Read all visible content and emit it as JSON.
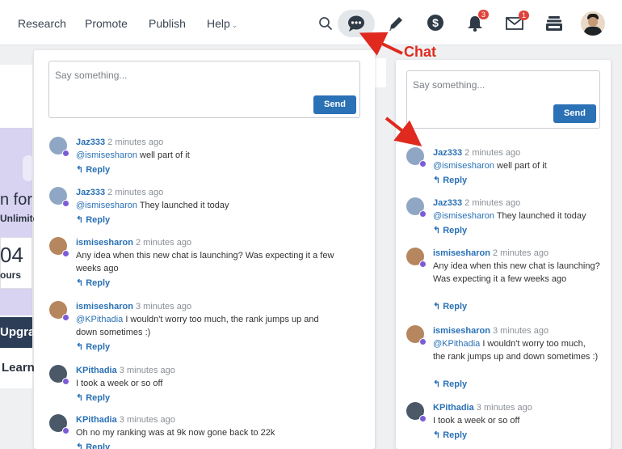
{
  "nav": {
    "links": [
      "Research",
      "Promote",
      "Publish",
      "Help"
    ],
    "notifications_badge": "3",
    "messages_badge": "1"
  },
  "background": {
    "text_for": "n for",
    "text_unlimited": "Unlimite",
    "number": "04",
    "hours": "ours",
    "upgrade": "Upgra",
    "learn": "Learn"
  },
  "annotation": {
    "label": "Chat"
  },
  "chat": {
    "placeholder": "Say something...",
    "send_label": "Send",
    "reply_label": "Reply"
  },
  "left_messages": [
    {
      "user": "Jaz333",
      "time": "2 minutes ago",
      "mention": "@ismisesharon",
      "text": " well part of it"
    },
    {
      "user": "Jaz333",
      "time": "2 minutes ago",
      "mention": "@ismisesharon",
      "text": " They launched it today"
    },
    {
      "user": "ismisesharon",
      "time": "2 minutes ago",
      "mention": "",
      "text": "Any idea when this new chat is launching? Was expecting it a few weeks ago"
    },
    {
      "user": "ismisesharon",
      "time": "3 minutes ago",
      "mention": "@KPithadia",
      "text": " I wouldn't worry too much, the rank jumps up and down sometimes :)"
    },
    {
      "user": "KPithadia",
      "time": "3 minutes ago",
      "mention": "",
      "text": "I took a week or so off"
    },
    {
      "user": "KPithadia",
      "time": "3 minutes ago",
      "mention": "",
      "text": "Oh no my ranking was at 9k now gone back to 22k"
    }
  ],
  "right_messages": [
    {
      "user": "Jaz333",
      "time": "2 minutes ago",
      "mention": "@ismisesharon",
      "text": " well part of it"
    },
    {
      "user": "Jaz333",
      "time": "2 minutes ago",
      "mention": "@ismisesharon",
      "text": " They launched it today"
    },
    {
      "user": "ismisesharon",
      "time": "2 minutes ago",
      "mention": "",
      "text": "Any idea when this new chat is launching? Was expecting it a few weeks ago"
    },
    {
      "user": "ismisesharon",
      "time": "3 minutes ago",
      "mention": "@KPithadia",
      "text": " I wouldn't worry too much, the rank jumps up and down sometimes :)"
    },
    {
      "user": "KPithadia",
      "time": "3 minutes ago",
      "mention": "",
      "text": "I took a week or so off"
    }
  ],
  "colors": {
    "accent": "#2a71b5",
    "badge": "#e0433b",
    "annotation_red": "#e02a1f",
    "avatar_dot": "#7c5cd6"
  }
}
